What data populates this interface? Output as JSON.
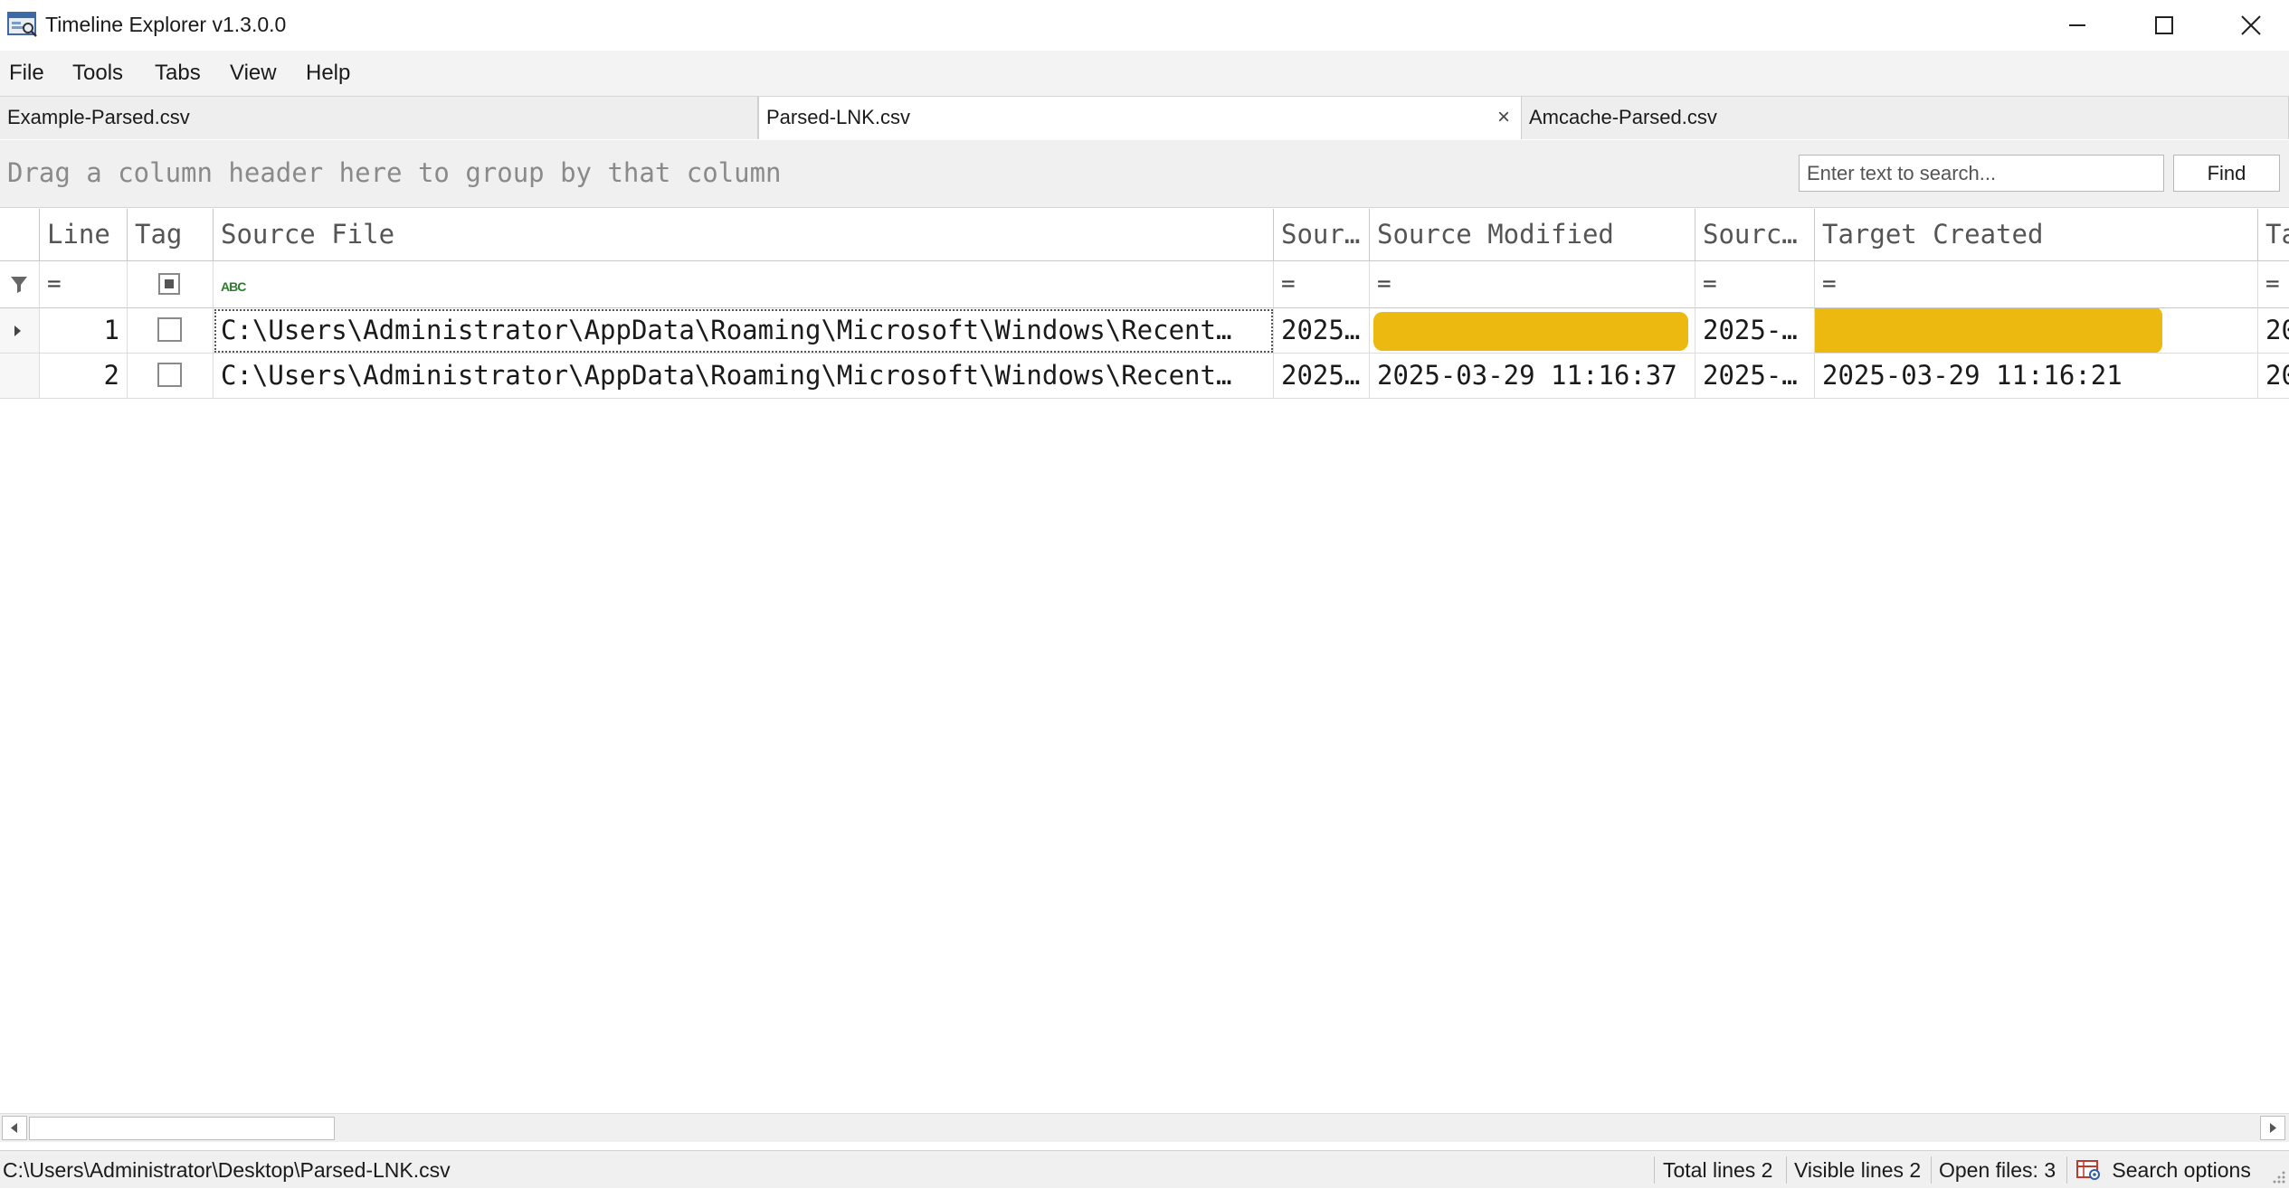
{
  "window": {
    "title": "Timeline Explorer v1.3.0.0"
  },
  "menu": [
    "File",
    "Tools",
    "Tabs",
    "View",
    "Help"
  ],
  "tabs": [
    {
      "label": "Example-Parsed.csv",
      "active": false
    },
    {
      "label": "Parsed-LNK.csv",
      "active": true,
      "close": "×"
    },
    {
      "label": "Amcache-Parsed.csv",
      "active": false
    }
  ],
  "group_panel": {
    "hint": "Drag a column header here to group by that column"
  },
  "search": {
    "placeholder": "Enter text to search...",
    "value": "",
    "find_label": "Find"
  },
  "grid": {
    "columns": [
      "Line",
      "Tag",
      "Source File",
      "Sour…",
      "Source Modified",
      "Sourc…",
      "Target Created",
      "Ta"
    ],
    "filters": {
      "equals": "=",
      "text_icon": "ABC"
    },
    "rows": [
      {
        "line": "1",
        "source_file": "C:\\Users\\Administrator\\AppData\\Roaming\\Microsoft\\Windows\\Recent…",
        "source_created": "2025…",
        "source_modified": "",
        "source_accessed": "2025-…",
        "target_created": "",
        "target_next": "20",
        "highlighted": true
      },
      {
        "line": "2",
        "source_file": "C:\\Users\\Administrator\\AppData\\Roaming\\Microsoft\\Windows\\Recent…",
        "source_created": "2025…",
        "source_modified": "2025-03-29 11:16:37",
        "source_accessed": "2025-…",
        "target_created": "2025-03-29 11:16:21",
        "target_next": "20",
        "highlighted": false
      }
    ],
    "highlight_color": "#EBB90F"
  },
  "status": {
    "path": "C:\\Users\\Administrator\\Desktop\\Parsed-LNK.csv",
    "total_lines": "Total lines 2",
    "visible_lines": "Visible lines 2",
    "open_files": "Open files: 3",
    "search_options": "Search options"
  }
}
